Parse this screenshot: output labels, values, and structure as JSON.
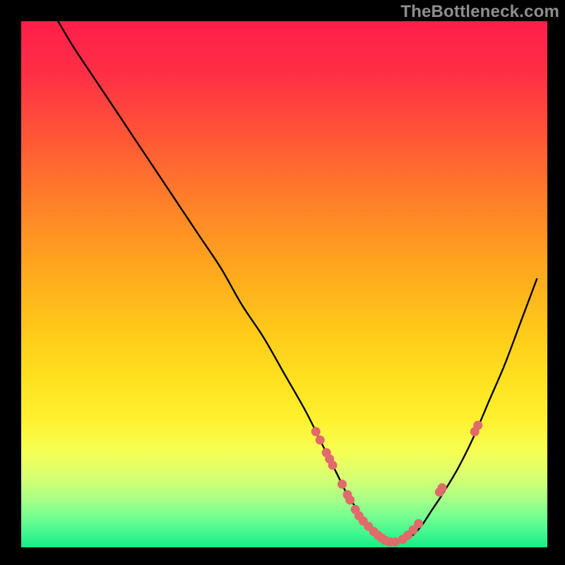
{
  "watermark": "TheBottleneck.com",
  "gradient": {
    "stops": [
      {
        "offset": 0.0,
        "color": "#ff1e4b"
      },
      {
        "offset": 0.1,
        "color": "#ff2f45"
      },
      {
        "offset": 0.22,
        "color": "#ff5636"
      },
      {
        "offset": 0.34,
        "color": "#ff7f29"
      },
      {
        "offset": 0.46,
        "color": "#ffa41e"
      },
      {
        "offset": 0.58,
        "color": "#ffc71a"
      },
      {
        "offset": 0.68,
        "color": "#ffe11f"
      },
      {
        "offset": 0.76,
        "color": "#fff230"
      },
      {
        "offset": 0.82,
        "color": "#f6ff55"
      },
      {
        "offset": 0.87,
        "color": "#d5ff74"
      },
      {
        "offset": 0.91,
        "color": "#a6ff88"
      },
      {
        "offset": 0.94,
        "color": "#78ff90"
      },
      {
        "offset": 0.97,
        "color": "#45f890"
      },
      {
        "offset": 1.0,
        "color": "#17ec85"
      }
    ]
  },
  "chart_data": {
    "type": "line",
    "title": "",
    "xlabel": "",
    "ylabel": "",
    "xlim": [
      0,
      100
    ],
    "ylim": [
      0,
      100
    ],
    "series": [
      {
        "name": "curve",
        "x": [
          7,
          10,
          14,
          18,
          22,
          26,
          30,
          34,
          38,
          42,
          46,
          50,
          54,
          57,
          60,
          62,
          64,
          66,
          68,
          70,
          72,
          74,
          76,
          78,
          80,
          83,
          86,
          89,
          92,
          95,
          98
        ],
        "y": [
          100,
          95,
          89,
          83,
          77,
          71,
          65,
          59,
          53,
          46,
          40,
          33,
          26,
          20,
          14,
          10,
          7,
          4,
          2,
          1,
          1,
          2,
          4,
          7,
          10,
          15,
          21,
          28,
          35,
          43,
          51
        ]
      }
    ],
    "markers": {
      "name": "dots",
      "color": "#e16a6a",
      "x": [
        56.0,
        56.8,
        58.0,
        58.6,
        59.2,
        61.0,
        62.0,
        62.5,
        63.5,
        64.2,
        65.0,
        66.0,
        67.0,
        67.8,
        68.5,
        69.2,
        70.1,
        71.1,
        72.5,
        73.5,
        74.5,
        75.5,
        79.5,
        80.0,
        86.2,
        86.8
      ],
      "y": [
        22.0,
        20.4,
        18.0,
        16.8,
        15.6,
        12.0,
        10.0,
        9.0,
        7.2,
        6.0,
        5.0,
        4.0,
        3.0,
        2.3,
        1.8,
        1.3,
        1.0,
        1.0,
        1.5,
        2.3,
        3.3,
        4.5,
        10.5,
        11.3,
        22.0,
        23.2
      ]
    }
  }
}
